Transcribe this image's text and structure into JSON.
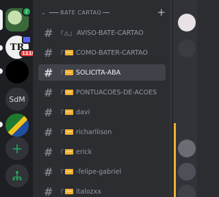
{
  "servers": {
    "srv2_text": "TR",
    "srv2_badge": "1110",
    "srv4_text": "SdM",
    "add_label": "+",
    "dir_label": "⋔"
  },
  "category": {
    "label": "BATE CARTAO",
    "add": "+"
  },
  "channels": [
    {
      "name": "AVISO-BATE-CARTAO",
      "deco": "『⚠』",
      "active": false
    },
    {
      "name": "COMO-BATER-CARTAO",
      "deco": "『",
      "active": false
    },
    {
      "name": "SOLICITA-ABA",
      "deco": "『",
      "active": true
    },
    {
      "name": "PONTUACOES-DE-ACOES",
      "deco": "『",
      "active": false
    },
    {
      "name": "davi",
      "deco": "『",
      "active": false
    },
    {
      "name": "richarllison",
      "deco": "『",
      "active": false
    },
    {
      "name": "erick",
      "deco": "『",
      "active": false
    },
    {
      "name": "-felipe-gabriel",
      "deco": "『",
      "active": false
    },
    {
      "name": "italozxx",
      "deco": "『",
      "active": false
    }
  ],
  "colors": {
    "rail_bg": "#1e1f22",
    "channel_bg": "#2b2d31",
    "active_bg": "#404249",
    "folder_icon": "#f0b232",
    "green_accent": "#23a55a",
    "badge_red": "#f23f43"
  }
}
